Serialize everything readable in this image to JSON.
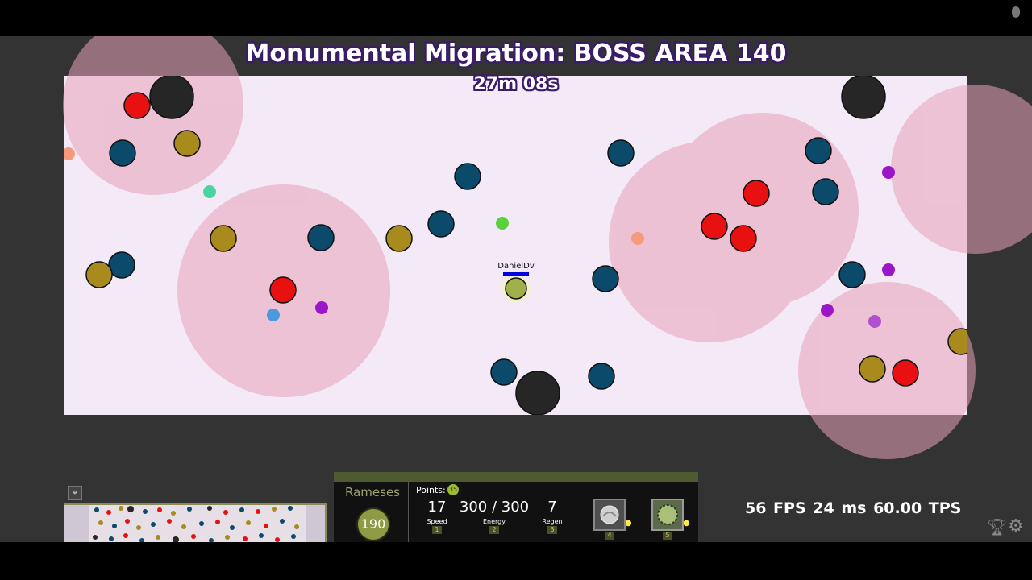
{
  "area": {
    "title": "Monumental Migration: BOSS AREA 140",
    "timer": "27m 08s"
  },
  "player": {
    "name": "DanielDv"
  },
  "hud": {
    "hero_name": "Rameses",
    "hero_level": "190",
    "points_label": "Points:",
    "points_value": "35",
    "stats": [
      {
        "value": "17",
        "label": "Speed",
        "key": "1"
      },
      {
        "value": "300 / 300",
        "label": "Energy",
        "key": "2"
      },
      {
        "value": "7",
        "label": "Regen",
        "key": "3"
      }
    ],
    "abilities": [
      {
        "key": "4",
        "dots": "●●●●●",
        "icon": "ability-boulder-icon"
      },
      {
        "key": "5",
        "dots": "●●●●●",
        "icon": "ability-ring-icon"
      }
    ]
  },
  "perf": {
    "fps": "56 FPS",
    "ping": "24 ms",
    "tps": "60.00 TPS"
  },
  "colors": {
    "area_bg": "#f4eaf7",
    "aura": "#f0bcd4",
    "red": "#e81010",
    "dark_blue": "#0b4a6a",
    "olive": "#a88a1d",
    "black": "#262626",
    "purple": "#9a16c8",
    "player": "#a0b048"
  }
}
